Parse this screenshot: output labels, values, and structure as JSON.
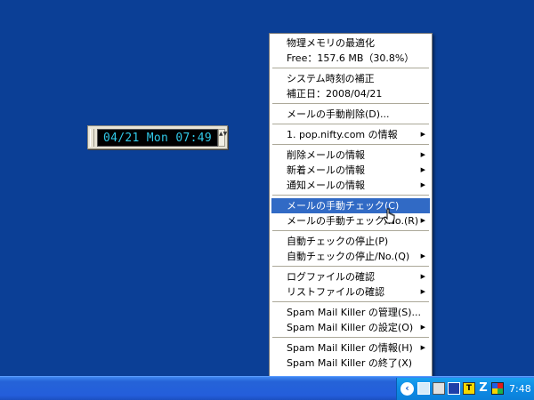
{
  "clock": {
    "display": "04/21 Mon 07:49",
    "scroll_glyph": "▲▼"
  },
  "menu": {
    "groups": [
      [
        {
          "label": "物理メモリの最適化",
          "submenu": false
        },
        {
          "label": "Free：157.6 MB（30.8%）",
          "submenu": false
        }
      ],
      [
        {
          "label": "システム時刻の補正",
          "submenu": false
        },
        {
          "label": "補正日：2008/04/21",
          "submenu": false
        }
      ],
      [
        {
          "label": "メールの手動削除(D)...",
          "submenu": false
        }
      ],
      [
        {
          "label": "1. pop.nifty.com の情報",
          "submenu": true
        }
      ],
      [
        {
          "label": "削除メールの情報",
          "submenu": true
        },
        {
          "label": "新着メールの情報",
          "submenu": true
        },
        {
          "label": "通知メールの情報",
          "submenu": true
        }
      ],
      [
        {
          "label": "メールの手動チェック(C)",
          "submenu": false,
          "highlighted": true
        },
        {
          "label": "メールの手動チェック/No.(R)",
          "submenu": true
        }
      ],
      [
        {
          "label": "自動チェックの停止(P)",
          "submenu": false
        },
        {
          "label": "自動チェックの停止/No.(Q)",
          "submenu": true
        }
      ],
      [
        {
          "label": "ログファイルの確認",
          "submenu": true
        },
        {
          "label": "リストファイルの確認",
          "submenu": true
        }
      ],
      [
        {
          "label": "Spam Mail Killer の管理(S)...",
          "submenu": false
        },
        {
          "label": "Spam Mail Killer の設定(O)",
          "submenu": true
        }
      ],
      [
        {
          "label": "Spam Mail Killer の情報(H)",
          "submenu": true
        },
        {
          "label": "Spam Mail Killer の終了(X)",
          "submenu": false
        }
      ]
    ],
    "submenu_arrow": "▶"
  },
  "taskbar": {
    "tray_expand": "‹",
    "tray_icons": [
      "network-icon",
      "monitor-icon",
      "shield-icon",
      "note-icon",
      "z-icon",
      "color-icon"
    ],
    "tray_z_glyph": "Z",
    "tray_note_glyph": "T",
    "clock": "7:48"
  },
  "colors": {
    "desktop": "#0b3f96",
    "highlight": "#316ac5",
    "clock_text": "#31c9e8"
  }
}
